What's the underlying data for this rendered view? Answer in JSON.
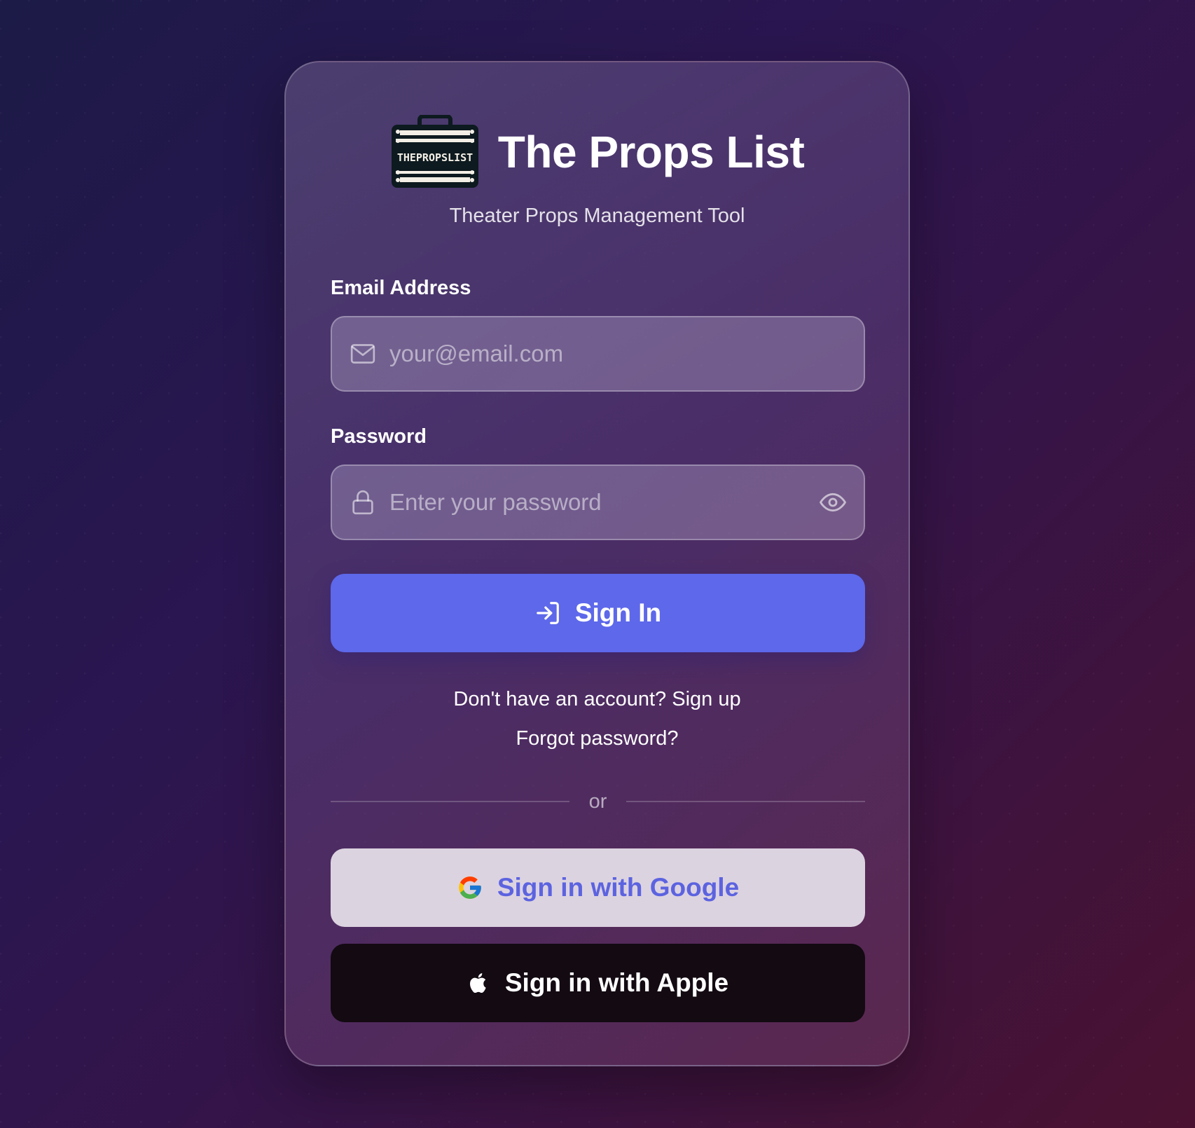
{
  "app": {
    "title": "The Props List",
    "subtitle": "Theater Props Management Tool",
    "logo_text": "THEPROPSLIST"
  },
  "form": {
    "email_label": "Email Address",
    "email_placeholder": "your@email.com",
    "email_value": "",
    "password_label": "Password",
    "password_placeholder": "Enter your password",
    "password_value": ""
  },
  "actions": {
    "sign_in": "Sign In",
    "signup_link": "Don't have an account? Sign up",
    "forgot_link": "Forgot password?",
    "divider": "or",
    "google": "Sign in with Google",
    "apple": "Sign in with Apple"
  },
  "icons": {
    "email": "mail-icon",
    "password": "lock-icon",
    "visibility": "eye-icon",
    "sign_in": "sign-in-icon",
    "google": "google-icon",
    "apple": "apple-icon"
  },
  "colors": {
    "primary": "#5d68ea",
    "google_text": "#5c63e0",
    "apple_bg": "#130a12",
    "google_bg": "#dcd3e0"
  }
}
